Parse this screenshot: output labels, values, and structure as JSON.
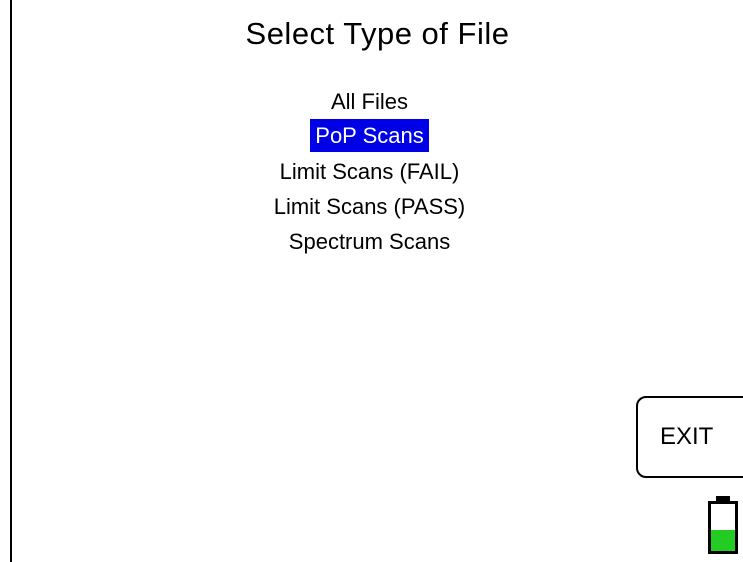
{
  "screen": {
    "title": "Select Type of File"
  },
  "file_types": {
    "selected_index": 1,
    "items": [
      {
        "label": "All Files"
      },
      {
        "label": "PoP Scans"
      },
      {
        "label": "Limit Scans (FAIL)"
      },
      {
        "label": "Limit Scans (PASS)"
      },
      {
        "label": "Spectrum Scans"
      }
    ]
  },
  "buttons": {
    "exit_label": "EXIT"
  },
  "status": {
    "battery_icon": "battery-icon",
    "battery_level_fraction": 0.45
  },
  "colors": {
    "selection_background": "#0000e6",
    "selection_text": "#ffffff",
    "battery_fill": "#22cc22"
  }
}
